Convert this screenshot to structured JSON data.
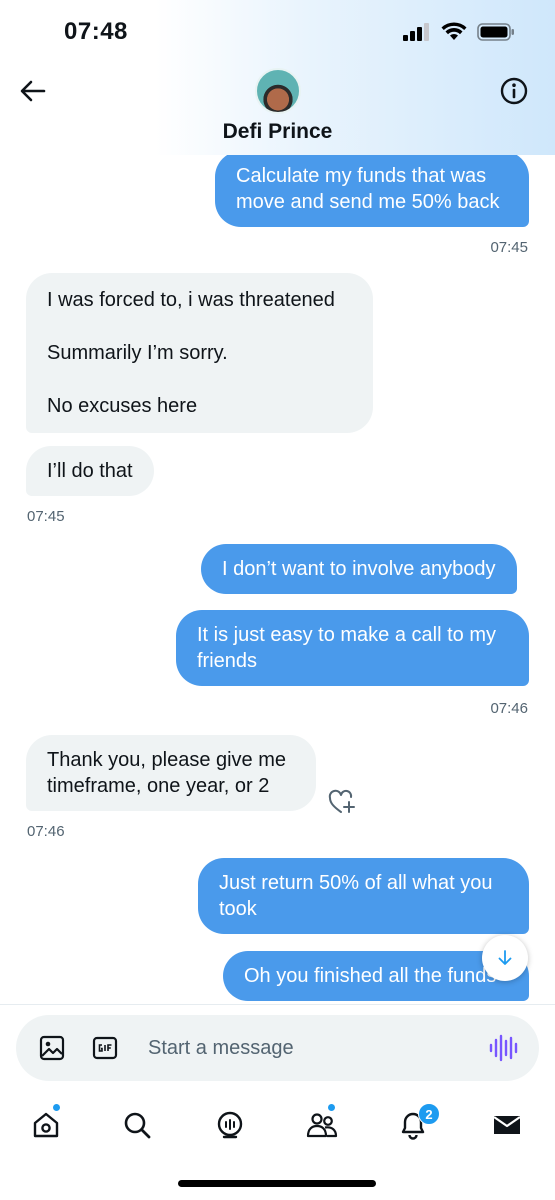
{
  "status_bar": {
    "time": "07:48"
  },
  "header": {
    "contact_name": "Defi Prince"
  },
  "messages": [
    {
      "direction": "sent",
      "text": "Calculate my funds that was move and send me 50% back"
    },
    {
      "direction": "sent",
      "timestamp": "07:45"
    },
    {
      "direction": "received",
      "lines": [
        "I was forced to, i was threatened",
        "Summarily I’m sorry.",
        "No excuses here"
      ]
    },
    {
      "direction": "received",
      "text": "I’ll do that"
    },
    {
      "direction": "received",
      "timestamp": "07:45"
    },
    {
      "direction": "sent",
      "text": "I don’t want to involve anybody"
    },
    {
      "direction": "sent",
      "text": "It is just easy to make a call to my friends"
    },
    {
      "direction": "sent",
      "timestamp": "07:46"
    },
    {
      "direction": "received",
      "text": "Thank you, please give me timeframe, one year, or 2"
    },
    {
      "direction": "received",
      "timestamp": "07:46"
    },
    {
      "direction": "sent",
      "text": "Just return 50% of all what you took"
    },
    {
      "direction": "sent",
      "text": "Oh you finished all the funds"
    }
  ],
  "composer": {
    "placeholder": "Start a message"
  },
  "tabbar": {
    "notifications_badge": "2"
  },
  "icons": {
    "back": "arrow-left-icon",
    "info": "info-icon",
    "image": "image-icon",
    "gif": "gif-icon",
    "voice": "voice-wave-icon",
    "reaction": "heart-plus-icon",
    "scroll": "arrow-down-icon"
  },
  "colors": {
    "sent_bubble": "#4a9aeb",
    "received_bubble": "#eff3f4",
    "accent": "#1d9bf0"
  }
}
